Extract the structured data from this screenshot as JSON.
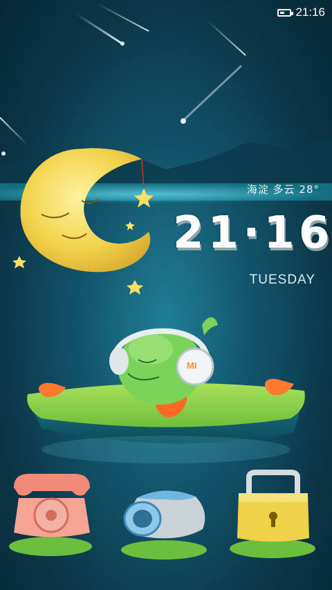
{
  "status_bar": {
    "time": "21:16",
    "battery_icon": "battery-icon"
  },
  "lockscreen": {
    "weather": "海淀 多云 28°",
    "time": "21·16",
    "day": "TUESDAY",
    "headphone_logo": "MI"
  },
  "shortcuts": [
    {
      "name": "phone",
      "icon": "phone-icon"
    },
    {
      "name": "camera",
      "icon": "camera-icon"
    },
    {
      "name": "unlock",
      "icon": "lock-icon"
    }
  ],
  "colors": {
    "background": "#13566d",
    "moon": "#f2d24a",
    "grass": "#8fd14a"
  }
}
